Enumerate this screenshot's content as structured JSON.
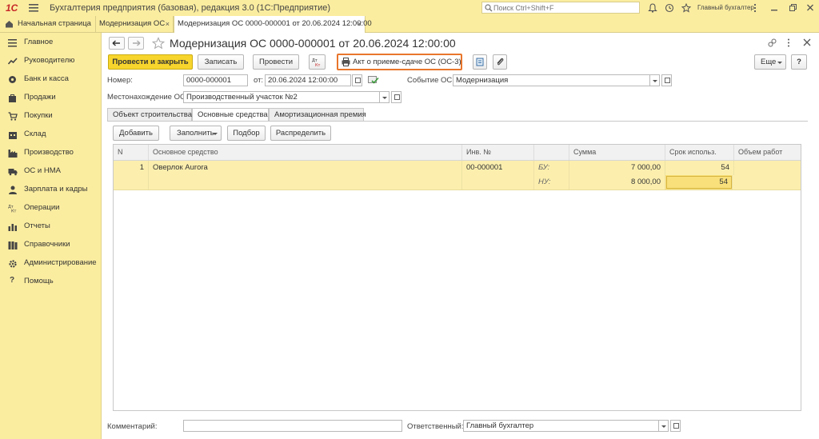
{
  "app": {
    "logo_text": "1С",
    "title": "Бухгалтерия предприятия (базовая), редакция 3.0  (1С:Предприятие)",
    "search_placeholder": "Поиск Ctrl+Shift+F",
    "user": "Главный бухгалтер"
  },
  "tabs": [
    {
      "label": "Начальная страница"
    },
    {
      "label": "Модернизация ОС",
      "close": "×"
    },
    {
      "label": "Модернизация ОС 0000-000001 от 20.06.2024 12:00:00",
      "close": "×"
    }
  ],
  "sidebar": {
    "items": [
      {
        "label": "Главное",
        "icon": "menu-lines-icon"
      },
      {
        "label": "Руководителю",
        "icon": "trend-icon"
      },
      {
        "label": "Банк и касса",
        "icon": "coins-icon"
      },
      {
        "label": "Продажи",
        "icon": "bag-icon"
      },
      {
        "label": "Покупки",
        "icon": "cart-icon"
      },
      {
        "label": "Склад",
        "icon": "warehouse-icon"
      },
      {
        "label": "Производство",
        "icon": "factory-icon"
      },
      {
        "label": "ОС и НМА",
        "icon": "truck-icon"
      },
      {
        "label": "Зарплата и кадры",
        "icon": "person-icon"
      },
      {
        "label": "Операции",
        "icon": "dt-kt-icon"
      },
      {
        "label": "Отчеты",
        "icon": "bar-chart-icon"
      },
      {
        "label": "Справочники",
        "icon": "books-icon"
      },
      {
        "label": "Администрирование",
        "icon": "gear-icon"
      },
      {
        "label": "Помощь",
        "icon": "question-icon"
      }
    ]
  },
  "document": {
    "title": "Модернизация ОС 0000-000001 от 20.06.2024 12:00:00",
    "toolbar": {
      "post_close": "Провести и закрыть",
      "save": "Записать",
      "post": "Провести",
      "dtkt": "Дт Кт",
      "print_act": "Акт о приеме-сдаче ОС (ОС-3)",
      "more": "Еще",
      "help": "?"
    },
    "form": {
      "number_label": "Номер:",
      "number_value": "0000-000001",
      "date_label": "от:",
      "date_value": "20.06.2024 12:00:00",
      "event_label": "Событие ОС:",
      "event_value": "Модернизация",
      "location_label": "Местонахождение ОС:",
      "location_value": "Производственный участок №2"
    },
    "tabs": [
      "Объект строительства",
      "Основные средства",
      "Амортизационная премия"
    ],
    "table_toolbar": {
      "add": "Добавить",
      "fill": "Заполнить",
      "pick": "Подбор",
      "distribute": "Распределить"
    },
    "table": {
      "columns": [
        "N",
        "Основное средство",
        "Инв. №",
        "",
        "Сумма",
        "Срок использ.",
        "Объем работ"
      ],
      "rows": [
        {
          "n": "1",
          "asset": "Оверлок Aurora",
          "inv": "00-000001",
          "bu_label": "БУ:",
          "bu_sum": "7 000,00",
          "bu_term": "54",
          "nu_label": "НУ:",
          "nu_sum": "8 000,00",
          "nu_term": "54"
        }
      ]
    },
    "footer": {
      "comment_label": "Комментарий:",
      "comment_value": "",
      "responsible_label": "Ответственный:",
      "responsible_value": "Главный бухгалтер"
    }
  },
  "colors": {
    "accent": "#f7d52c",
    "highlight_border": "#e8762c",
    "panel": "#fbeda0"
  }
}
